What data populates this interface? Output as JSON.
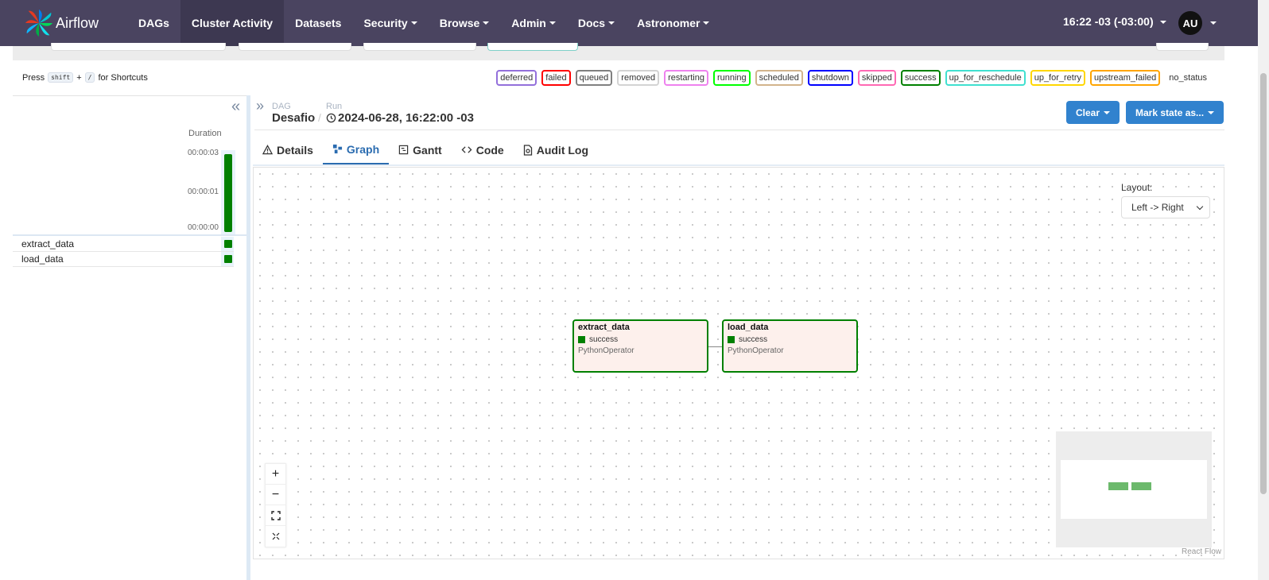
{
  "nav": {
    "brand": "Airflow",
    "items": [
      {
        "label": "DAGs",
        "dropdown": false,
        "active": false
      },
      {
        "label": "Cluster Activity",
        "dropdown": false,
        "active": true
      },
      {
        "label": "Datasets",
        "dropdown": false,
        "active": false
      },
      {
        "label": "Security",
        "dropdown": true,
        "active": false
      },
      {
        "label": "Browse",
        "dropdown": true,
        "active": false
      },
      {
        "label": "Admin",
        "dropdown": true,
        "active": false
      },
      {
        "label": "Docs",
        "dropdown": true,
        "active": false
      },
      {
        "label": "Astronomer",
        "dropdown": true,
        "active": false
      }
    ],
    "clock": "16:22 -03 (-03:00)",
    "user_initials": "AU"
  },
  "shortcuts": {
    "prefix": "Press",
    "key1": "shift",
    "plus": "+",
    "key2": "/",
    "suffix": "for Shortcuts"
  },
  "legend": [
    {
      "label": "deferred",
      "color": "#9370db"
    },
    {
      "label": "failed",
      "color": "#ff0000"
    },
    {
      "label": "queued",
      "color": "#808080"
    },
    {
      "label": "removed",
      "color": "#d3d3d3"
    },
    {
      "label": "restarting",
      "color": "#ee82ee"
    },
    {
      "label": "running",
      "color": "#00ff00"
    },
    {
      "label": "scheduled",
      "color": "#d2b48c"
    },
    {
      "label": "shutdown",
      "color": "#0000ff"
    },
    {
      "label": "skipped",
      "color": "#ff69b4"
    },
    {
      "label": "success",
      "color": "#008000"
    },
    {
      "label": "up_for_reschedule",
      "color": "#40e0d0"
    },
    {
      "label": "up_for_retry",
      "color": "#ffd700"
    },
    {
      "label": "upstream_failed",
      "color": "#ffa500"
    },
    {
      "label": "no_status",
      "color": "#ffffff"
    }
  ],
  "grid": {
    "duration_label": "Duration",
    "ticks": [
      "00:00:03",
      "00:00:01",
      "00:00:00"
    ],
    "tasks": [
      {
        "name": "extract_data",
        "state": "success"
      },
      {
        "name": "load_data",
        "state": "success"
      }
    ]
  },
  "breadcrumb": {
    "dag_label": "DAG",
    "dag_value": "Desafio",
    "run_label": "Run",
    "run_value": "2024-06-28, 16:22:00 -03"
  },
  "actions": {
    "clear": "Clear",
    "mark_state": "Mark state as..."
  },
  "tabs": [
    {
      "label": "Details",
      "icon": "warning-icon",
      "active": false
    },
    {
      "label": "Graph",
      "icon": "graph-icon",
      "active": true
    },
    {
      "label": "Gantt",
      "icon": "gantt-icon",
      "active": false
    },
    {
      "label": "Code",
      "icon": "code-icon",
      "active": false
    },
    {
      "label": "Audit Log",
      "icon": "document-icon",
      "active": false
    }
  ],
  "graph": {
    "layout_label": "Layout:",
    "layout_value": "Left -> Right",
    "nodes": [
      {
        "name": "extract_data",
        "state": "success",
        "operator": "PythonOperator"
      },
      {
        "name": "load_data",
        "state": "success",
        "operator": "PythonOperator"
      }
    ],
    "attribution": "React Flow"
  }
}
